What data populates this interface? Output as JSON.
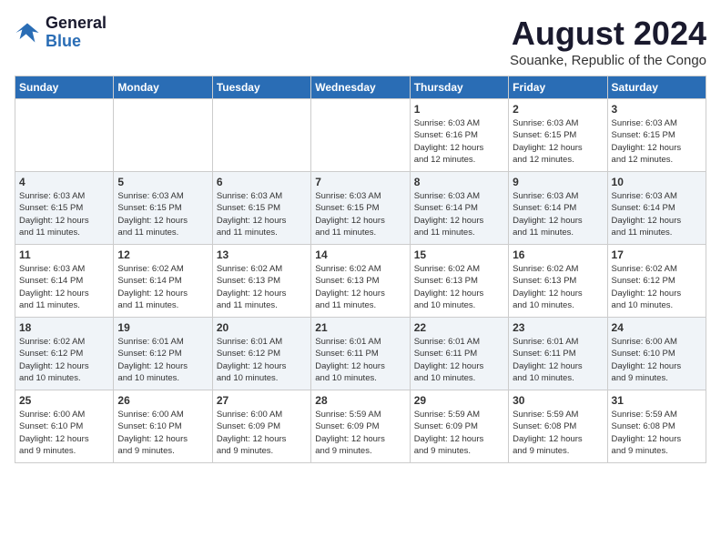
{
  "header": {
    "logo_general": "General",
    "logo_blue": "Blue",
    "main_title": "August 2024",
    "subtitle": "Souanke, Republic of the Congo"
  },
  "days_of_week": [
    "Sunday",
    "Monday",
    "Tuesday",
    "Wednesday",
    "Thursday",
    "Friday",
    "Saturday"
  ],
  "weeks": [
    [
      {
        "day": "",
        "info": ""
      },
      {
        "day": "",
        "info": ""
      },
      {
        "day": "",
        "info": ""
      },
      {
        "day": "",
        "info": ""
      },
      {
        "day": "1",
        "info": "Sunrise: 6:03 AM\nSunset: 6:16 PM\nDaylight: 12 hours\nand 12 minutes."
      },
      {
        "day": "2",
        "info": "Sunrise: 6:03 AM\nSunset: 6:15 PM\nDaylight: 12 hours\nand 12 minutes."
      },
      {
        "day": "3",
        "info": "Sunrise: 6:03 AM\nSunset: 6:15 PM\nDaylight: 12 hours\nand 12 minutes."
      }
    ],
    [
      {
        "day": "4",
        "info": "Sunrise: 6:03 AM\nSunset: 6:15 PM\nDaylight: 12 hours\nand 11 minutes."
      },
      {
        "day": "5",
        "info": "Sunrise: 6:03 AM\nSunset: 6:15 PM\nDaylight: 12 hours\nand 11 minutes."
      },
      {
        "day": "6",
        "info": "Sunrise: 6:03 AM\nSunset: 6:15 PM\nDaylight: 12 hours\nand 11 minutes."
      },
      {
        "day": "7",
        "info": "Sunrise: 6:03 AM\nSunset: 6:15 PM\nDaylight: 12 hours\nand 11 minutes."
      },
      {
        "day": "8",
        "info": "Sunrise: 6:03 AM\nSunset: 6:14 PM\nDaylight: 12 hours\nand 11 minutes."
      },
      {
        "day": "9",
        "info": "Sunrise: 6:03 AM\nSunset: 6:14 PM\nDaylight: 12 hours\nand 11 minutes."
      },
      {
        "day": "10",
        "info": "Sunrise: 6:03 AM\nSunset: 6:14 PM\nDaylight: 12 hours\nand 11 minutes."
      }
    ],
    [
      {
        "day": "11",
        "info": "Sunrise: 6:03 AM\nSunset: 6:14 PM\nDaylight: 12 hours\nand 11 minutes."
      },
      {
        "day": "12",
        "info": "Sunrise: 6:02 AM\nSunset: 6:14 PM\nDaylight: 12 hours\nand 11 minutes."
      },
      {
        "day": "13",
        "info": "Sunrise: 6:02 AM\nSunset: 6:13 PM\nDaylight: 12 hours\nand 11 minutes."
      },
      {
        "day": "14",
        "info": "Sunrise: 6:02 AM\nSunset: 6:13 PM\nDaylight: 12 hours\nand 11 minutes."
      },
      {
        "day": "15",
        "info": "Sunrise: 6:02 AM\nSunset: 6:13 PM\nDaylight: 12 hours\nand 10 minutes."
      },
      {
        "day": "16",
        "info": "Sunrise: 6:02 AM\nSunset: 6:13 PM\nDaylight: 12 hours\nand 10 minutes."
      },
      {
        "day": "17",
        "info": "Sunrise: 6:02 AM\nSunset: 6:12 PM\nDaylight: 12 hours\nand 10 minutes."
      }
    ],
    [
      {
        "day": "18",
        "info": "Sunrise: 6:02 AM\nSunset: 6:12 PM\nDaylight: 12 hours\nand 10 minutes."
      },
      {
        "day": "19",
        "info": "Sunrise: 6:01 AM\nSunset: 6:12 PM\nDaylight: 12 hours\nand 10 minutes."
      },
      {
        "day": "20",
        "info": "Sunrise: 6:01 AM\nSunset: 6:12 PM\nDaylight: 12 hours\nand 10 minutes."
      },
      {
        "day": "21",
        "info": "Sunrise: 6:01 AM\nSunset: 6:11 PM\nDaylight: 12 hours\nand 10 minutes."
      },
      {
        "day": "22",
        "info": "Sunrise: 6:01 AM\nSunset: 6:11 PM\nDaylight: 12 hours\nand 10 minutes."
      },
      {
        "day": "23",
        "info": "Sunrise: 6:01 AM\nSunset: 6:11 PM\nDaylight: 12 hours\nand 10 minutes."
      },
      {
        "day": "24",
        "info": "Sunrise: 6:00 AM\nSunset: 6:10 PM\nDaylight: 12 hours\nand 9 minutes."
      }
    ],
    [
      {
        "day": "25",
        "info": "Sunrise: 6:00 AM\nSunset: 6:10 PM\nDaylight: 12 hours\nand 9 minutes."
      },
      {
        "day": "26",
        "info": "Sunrise: 6:00 AM\nSunset: 6:10 PM\nDaylight: 12 hours\nand 9 minutes."
      },
      {
        "day": "27",
        "info": "Sunrise: 6:00 AM\nSunset: 6:09 PM\nDaylight: 12 hours\nand 9 minutes."
      },
      {
        "day": "28",
        "info": "Sunrise: 5:59 AM\nSunset: 6:09 PM\nDaylight: 12 hours\nand 9 minutes."
      },
      {
        "day": "29",
        "info": "Sunrise: 5:59 AM\nSunset: 6:09 PM\nDaylight: 12 hours\nand 9 minutes."
      },
      {
        "day": "30",
        "info": "Sunrise: 5:59 AM\nSunset: 6:08 PM\nDaylight: 12 hours\nand 9 minutes."
      },
      {
        "day": "31",
        "info": "Sunrise: 5:59 AM\nSunset: 6:08 PM\nDaylight: 12 hours\nand 9 minutes."
      }
    ]
  ]
}
